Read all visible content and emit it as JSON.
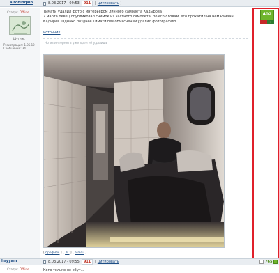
{
  "post1": {
    "username": "alroninqain",
    "date": "8.03.2017 - 09:53",
    "post_number": "911",
    "quote_label": "цитировать",
    "status_label": "Статус:",
    "status_value": "Offline",
    "avatar_caption": "Шутник",
    "registered": "Регистрация: 1.05.12",
    "messages": "Сообщений: 34",
    "text_lines": [
      "Тимати удалил фото с интерьером личного самолёта Кадырова",
      "7 марта певец опубликовал снимок из частного самолёта: по его словам, его прокатил на нём Рамзан",
      "Кадыров. Однако позднее Тимати без объяснений удалил фотографию."
    ],
    "source_link": "источник",
    "quote_text": "Но из интернета уже хрен чё удалишь",
    "footer": {
      "profile": "профиль",
      "pm": "ЛС",
      "email": "e-mail"
    },
    "rating": "402",
    "vote_minus": "−",
    "vote_plus": "+"
  },
  "post2": {
    "username": "hsyyam",
    "date": "8.03.2017 - 09:55",
    "post_number": "911",
    "quote_label": "цитировать",
    "status_label": "Статус:",
    "status_value": "Offline",
    "text": "Кого только не ебут...",
    "rating": "765"
  },
  "colors": {
    "accent_red": "#e0202a",
    "rating_green": "#6fb52c",
    "link_blue": "#1f4f86"
  }
}
